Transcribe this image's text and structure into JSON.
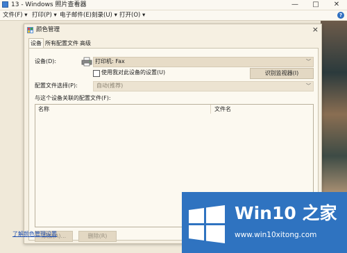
{
  "viewer": {
    "title": "13 - Windows 照片查看器",
    "menu": [
      "文件(F)",
      "打印(P)",
      "电子邮件(E)",
      "刻录(U)",
      "打开(O)"
    ],
    "menu_carets": [
      "▾",
      "▾",
      "",
      "▾",
      "▾"
    ],
    "help_label": "?"
  },
  "window_controls": {
    "minimize": "—",
    "maximize": "□",
    "close": "✕"
  },
  "dialog": {
    "title": "颜色管理",
    "close": "×",
    "tabs": [
      "设备",
      "所有配置文件",
      "高级"
    ],
    "active_tab": 0,
    "device_label": "设备(D):",
    "device_value": "打印机: Fax",
    "use_settings_label": "使用我对此设备的设置(U)",
    "use_settings_checked": false,
    "identify_button": "识别监视器(I)",
    "profile_selection_label": "配置文件选择(P):",
    "profile_selection_value": "自动(推荐)",
    "associated_label": "与这个设备关联的配置文件(F):",
    "columns": [
      "名称",
      "文件名"
    ],
    "rows": [],
    "add_button": "添加(A)...",
    "remove_button": "删除(R)",
    "learn_link": "了解颜色管理设置"
  },
  "watermark": {
    "brand_prefix": "Win10",
    "brand_suffix": " 之家",
    "url": "www.win10xitong.com",
    "colors": {
      "background": "#2f73c0",
      "logo": "#ffffff"
    }
  }
}
